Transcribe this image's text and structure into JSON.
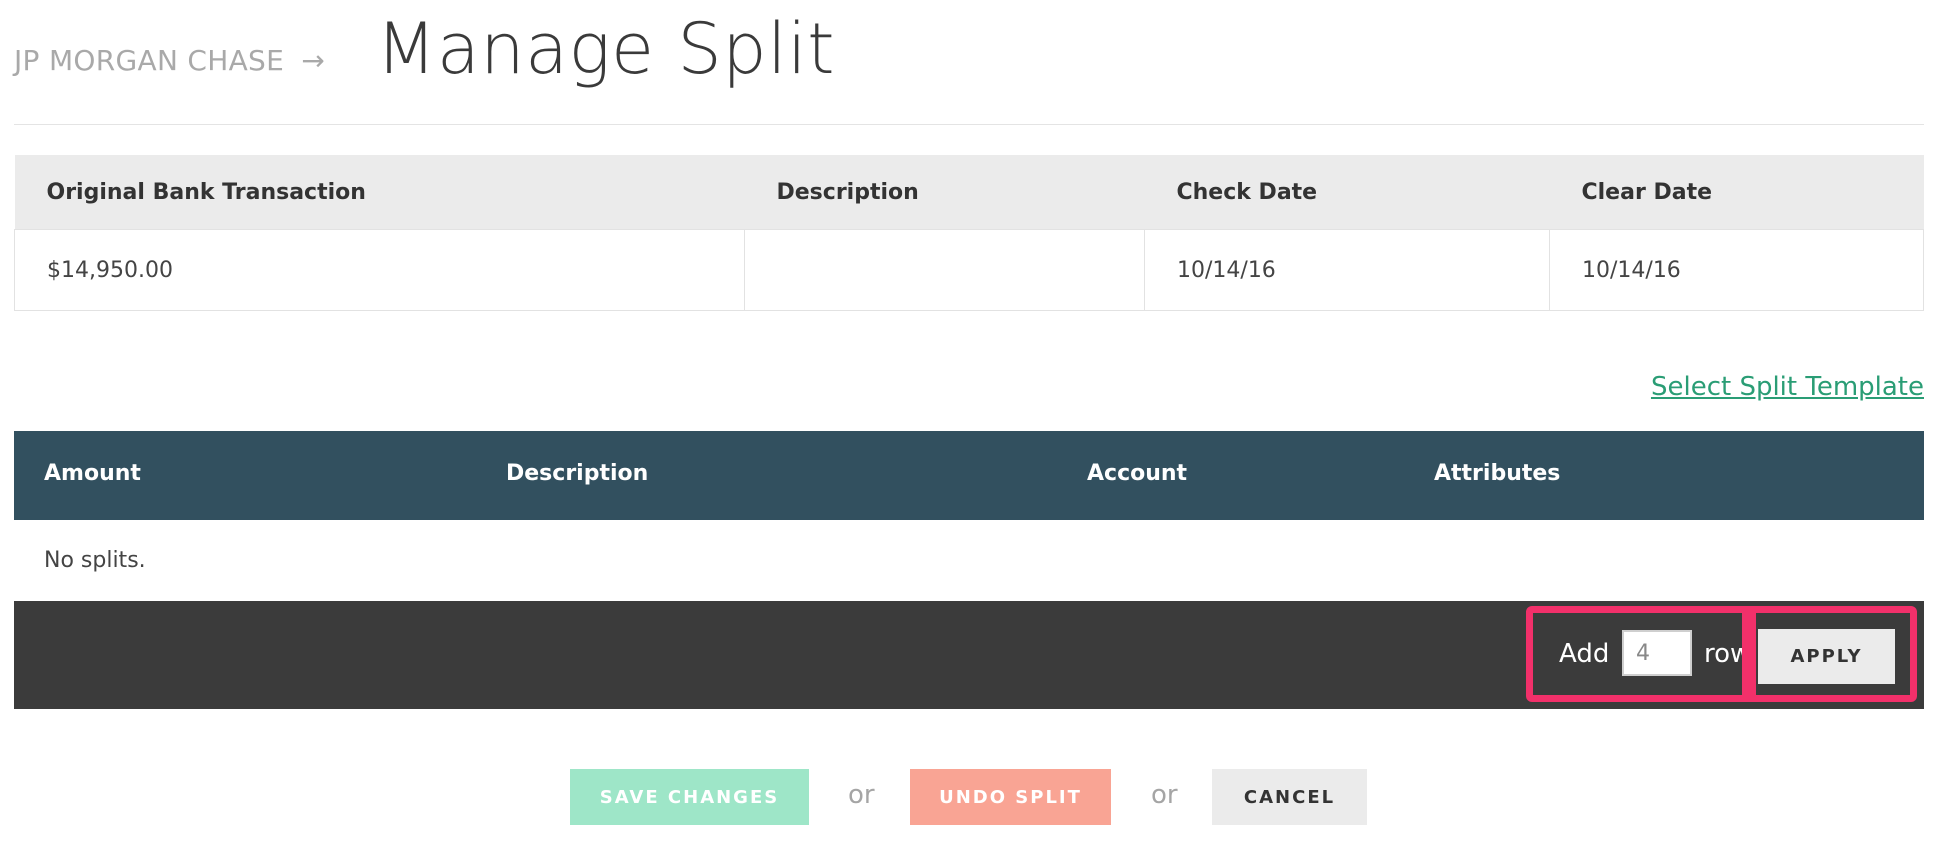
{
  "header": {
    "breadcrumb": "JP MORGAN CHASE",
    "arrow": "→",
    "title": "Manage Split"
  },
  "original_table": {
    "columns": [
      "Original Bank Transaction",
      "Description",
      "Check Date",
      "Clear Date"
    ],
    "row": [
      "$14,950.00",
      "",
      "10/14/16",
      "10/14/16"
    ]
  },
  "template_link": "Select Split Template",
  "split_table": {
    "columns": [
      "Amount",
      "Description",
      "Account",
      "Attributes"
    ],
    "empty_message": "No splits.",
    "add_label": "Add",
    "rows_value": "4",
    "rows_label": "rows",
    "apply_label": "APPLY"
  },
  "actions": {
    "save_label": "SAVE CHANGES",
    "or_1": "or",
    "undo_label": "UNDO SPLIT",
    "or_2": "or",
    "cancel_label": "CANCEL"
  },
  "colors": {
    "table_header": "#32505f",
    "footer_bar": "#3b3b3b",
    "highlight": "#f2306a",
    "save": "#9ee6c8",
    "undo": "#f9a494",
    "link": "#2a9d75"
  }
}
